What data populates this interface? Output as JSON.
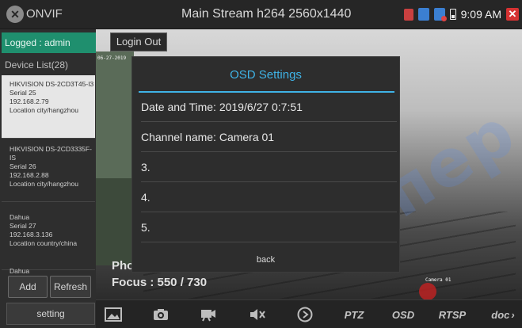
{
  "app": {
    "name": "ONVIF",
    "stream_title": "Main Stream h264 2560x1440",
    "clock": "9:09 AM"
  },
  "sidebar": {
    "logged": "Logged : admin",
    "device_list_title": "Device List(28)",
    "devices": [
      {
        "name": "HIKVISION DS-2CD3T45-I3",
        "serial": "Serial 25",
        "ip": "192.168.2.79",
        "location": "Location city/hangzhou",
        "selected": true
      },
      {
        "name": "HIKVISION DS-2CD3335F-IS",
        "serial": "Serial 26",
        "ip": "192.168.2.88",
        "location": "Location city/hangzhou",
        "selected": false
      },
      {
        "name": "Dahua",
        "serial": "Serial 27",
        "ip": "192.168.3.136",
        "location": "Location country/china",
        "selected": false
      },
      {
        "name": "Dahua",
        "serial": "",
        "ip": "",
        "location": "",
        "selected": false
      }
    ],
    "add_label": "Add",
    "refresh_label": "Refresh",
    "setting_label": "setting"
  },
  "video": {
    "login_out": "Login Out",
    "timestamp": "06-27-2019",
    "photo_text": "Photo Format",
    "focus_text": "Focus : 550 / 730",
    "camera_label": "Camera 01",
    "watermark": "супер"
  },
  "dialog": {
    "title": "OSD Settings",
    "rows": [
      "Date and Time: 2019/6/27 0:7:51",
      "Channel name: Camera 01",
      "3.",
      "4.",
      "5."
    ],
    "back_label": "back"
  },
  "toolbar": {
    "ptz": "PTZ",
    "osd": "OSD",
    "rtsp": "RTSP",
    "doc": "doc"
  },
  "colors": {
    "accent": "#3fb3e6",
    "logged_bg": "#1f8f6e",
    "close": "#d63232"
  }
}
